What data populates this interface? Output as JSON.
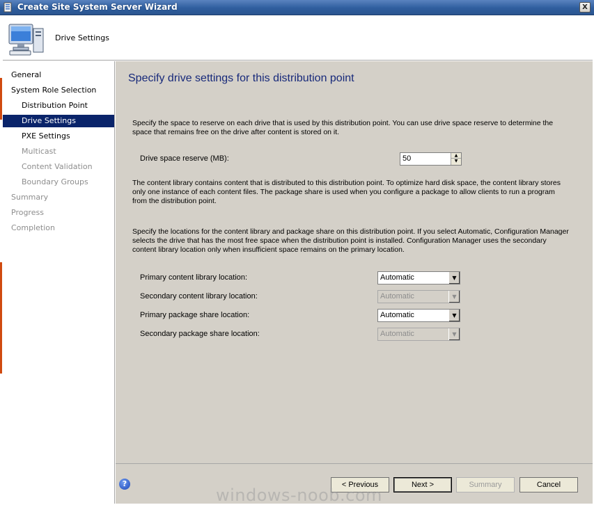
{
  "window": {
    "title": "Create Site System Server Wizard",
    "close_label": "X"
  },
  "header": {
    "title": "Drive Settings",
    "icon": "computer-icon"
  },
  "sidebar": {
    "items": [
      {
        "label": "General"
      },
      {
        "label": "System Role Selection"
      },
      {
        "label": "Distribution Point"
      },
      {
        "label": "Drive Settings"
      },
      {
        "label": "PXE Settings"
      },
      {
        "label": "Multicast"
      },
      {
        "label": "Content Validation"
      },
      {
        "label": "Boundary Groups"
      },
      {
        "label": "Summary"
      },
      {
        "label": "Progress"
      },
      {
        "label": "Completion"
      }
    ]
  },
  "main": {
    "heading": "Specify drive settings for this distribution point",
    "para1": "Specify the space to reserve on each drive that is used by this distribution point. You can use drive space reserve to determine the space that remains free on the drive after content is stored on it.",
    "reserve_label": "Drive space reserve (MB):",
    "reserve_value": "50",
    "para2": "The content library contains content that is distributed to this distribution point. To optimize hard disk space, the content library stores only one instance of each content files. The package share is used when you configure a package to allow clients to run a program from the distribution point.",
    "para3": "Specify the locations for the content library and package share on this distribution point. If you select Automatic, Configuration Manager selects the drive that has the most free space when the distribution point is installed. Configuration Manager uses the secondary content library location only when insufficient space remains on the primary location.",
    "locations": [
      {
        "label": "Primary content library location:",
        "value": "Automatic"
      },
      {
        "label": "Secondary content library location:",
        "value": "Automatic"
      },
      {
        "label": "Primary package share location:",
        "value": "Automatic"
      },
      {
        "label": "Secondary package share location:",
        "value": "Automatic"
      }
    ]
  },
  "footer": {
    "help": "?",
    "previous": "< Previous",
    "next": "Next >",
    "summary": "Summary",
    "cancel": "Cancel"
  },
  "watermark": "windows-noob.com",
  "colors": {
    "titlebar": "#2f5e9e",
    "nav_active": "#0a246a",
    "heading": "#17297a",
    "panel": "#d4d0c8"
  }
}
